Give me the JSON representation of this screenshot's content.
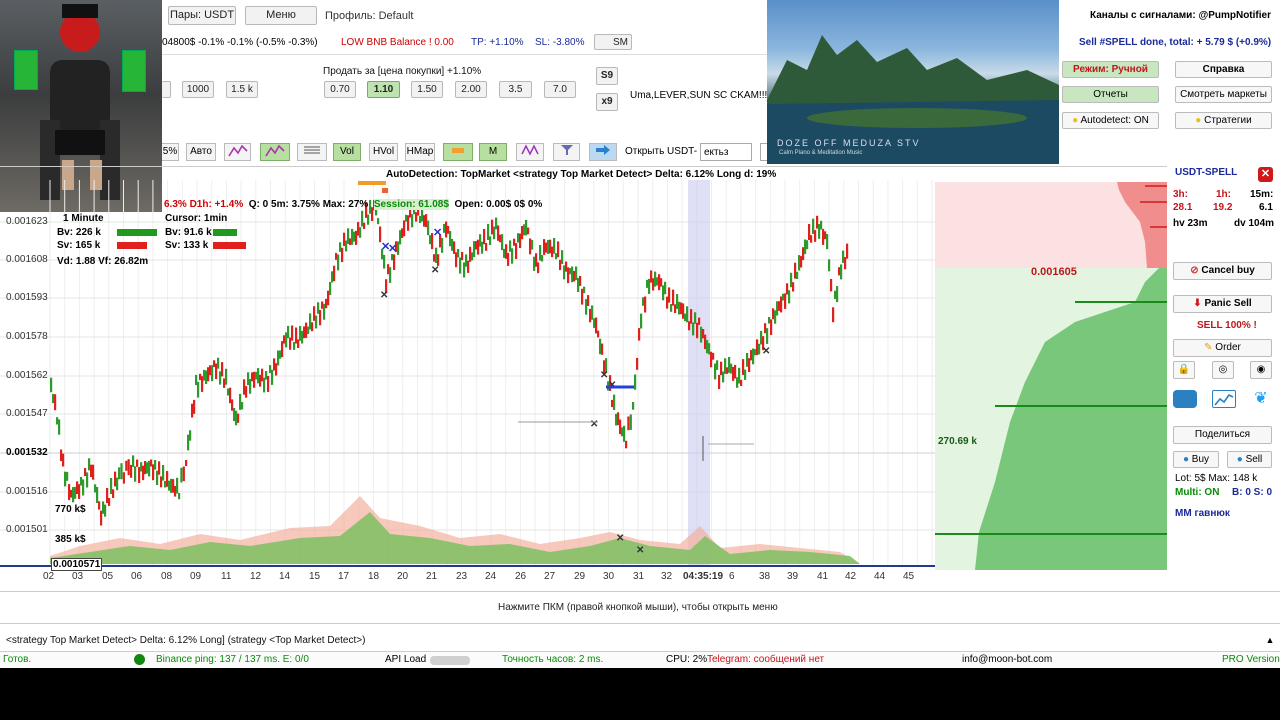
{
  "header": {
    "pairs_button": "Пары: USDT",
    "menu_button": "Меню",
    "profile": "Профиль: Default",
    "ticker_line": "04800$  -0.1% -0.1% (-0.5% -0.3%)",
    "bnb_warning": "LOW BNB Balance ! 0.00",
    "tp": "TP: +1.10%",
    "sl": "SL: -3.80%",
    "sm_label": "SM"
  },
  "sell_panel": {
    "title": "Продать за [цена покупки] +1.10%",
    "left_buttons": [
      "1000",
      "1.5 k"
    ],
    "percent_buttons": [
      "0.70",
      "1.10",
      "1.50",
      "2.00",
      "3.5",
      "7.0"
    ],
    "selected": "1.10",
    "s9": "S9",
    "x9": "x9",
    "note": "Uma,LEVER,SUN SC CKAM!!!"
  },
  "toolbar": {
    "pct": "5%",
    "auto": "Авто",
    "vol": "Vol",
    "hvol": "HVol",
    "hmap": "HMap",
    "m": "M",
    "open_label": "Открыть USDT-",
    "open_input": "ектьз"
  },
  "video": {
    "overlay_title": "DOZE OFF MEDUZA STV",
    "overlay_sub": "Calm Piano & Meditation Music"
  },
  "signals": {
    "channels": "Каналы с сигналами:  @PumpNotifier",
    "done_text": "Sell #SPELL done, total:",
    "done_value": "+ 5.79 $ (+0.9%)",
    "mode": "Режим: Ручной",
    "help": "Справка",
    "reports": "Отчеты",
    "view_markets": "Смотреть маркеты",
    "autodetect": "Autodetect: ON",
    "strategies": "Стратегии"
  },
  "chart_header": {
    "title": "AutoDetection: TopMarket <strategy Top Market Detect>  Delta: 6.12%   Long d: 19%",
    "stats_red": "6.3%  D1h: +1.4%",
    "stats_rest": "Q: 0   5m: 3.75%   Max: 27%",
    "session": "Session: 61.08$",
    "open": "Open: 0.00$   0$   0%"
  },
  "legend": {
    "interval": "1 Minute",
    "bv": "Bv: 226 k",
    "sv": "Sv: 165 k",
    "vd": "Vd: 1.88 Vf: 26.82m",
    "cursor": "Cursor: 1min",
    "cbv": "Bv: 91.6 k",
    "csv": "Sv: 133 k",
    "vol1": "770 k$",
    "vol2": "385 k$",
    "min_price": "0.0010571"
  },
  "y_labels": [
    "0.001623",
    "0.001608",
    "0.001593",
    "0.001578",
    "0.001562",
    "0.001547",
    "0.001532",
    "0.001516",
    "0.001501"
  ],
  "x_labels": [
    "02",
    "03",
    "05",
    "06",
    "08",
    "09",
    "11",
    "12",
    "14",
    "15",
    "17",
    "18",
    "20",
    "21",
    "23",
    "24",
    "26",
    "27",
    "29",
    "30",
    "31",
    "32",
    "33",
    "04:35:19",
    "6",
    "38",
    "39",
    "41",
    "42",
    "44",
    "45"
  ],
  "orderbook": {
    "price": "0.001605",
    "vol": "270.69 k"
  },
  "right_panel": {
    "pair": "USDT-SPELL",
    "h3_label": "3h:",
    "h1_label": "1h:",
    "m15_label": "15m:",
    "h3_value": "28.1",
    "h1_value": "19.2",
    "m15_value": "6.1",
    "hv": "hv 23m",
    "dv": "dv 104m",
    "cancel_buy": "Cancel buy",
    "panic_sell": "Panic Sell",
    "sell100": "SELL 100% !",
    "order": "Order",
    "share": "Поделиться",
    "buy": "Buy",
    "sell": "Sell",
    "lot": "Lot: 5$   Max: 148 k",
    "multi": "Multi: ON",
    "bs": "B: 0  S: 0",
    "mm": "MM гавнюк"
  },
  "hint": "Нажмите ПКМ (правой кнопкой мыши), чтобы открыть меню",
  "log_line": "<strategy Top Market Detect>  Delta: 6.12%  Long] (strategy <Top Market Detect>)",
  "status": {
    "ready": "Готов.",
    "ping": "Binance ping: 137 / 137 ms.   E: 0/0",
    "api": "API Load",
    "clock": "Точность часов: 2 ms.",
    "cpu": "CPU: 2%",
    "telegram": "Telegram: сообщений нет",
    "email": "info@moon-bot.com",
    "version": "PRO Version"
  },
  "colors": {
    "up": "#2e9a2e",
    "down": "#e0201c",
    "accent": "#c00000"
  }
}
